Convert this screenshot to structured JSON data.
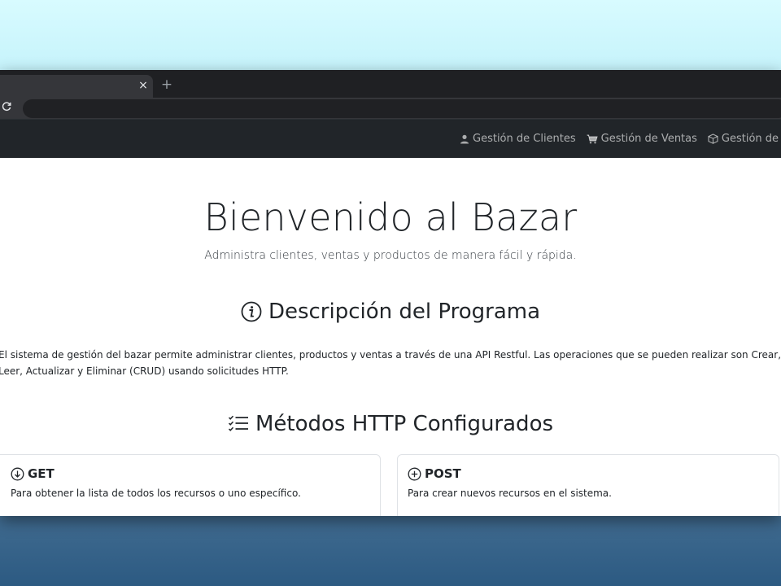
{
  "browser": {
    "tab_close": "×",
    "new_tab": "+",
    "reload": "C",
    "address": ""
  },
  "navbar": {
    "links": [
      {
        "label": "Gestión de Clientes",
        "icon": "person-icon"
      },
      {
        "label": "Gestión de Ventas",
        "icon": "cart-icon"
      },
      {
        "label": "Gestión de Productos",
        "icon": "box-icon"
      }
    ]
  },
  "hero": {
    "title": "Bienvenido al Bazar",
    "subtitle": "Administra clientes, ventas y productos de manera fácil y rápida."
  },
  "description": {
    "title": "Descripción del Programa",
    "icon": "info-circle-icon",
    "text": "El sistema de gestión del bazar permite administrar clientes, productos y ventas a través de una API Restful. Las operaciones que se pueden realizar son Crear, Leer, Actualizar y Eliminar (CRUD) usando solicitudes HTTP."
  },
  "methods": {
    "title": "Métodos HTTP Configurados",
    "icon": "list-check-icon",
    "cards": [
      {
        "name": "GET",
        "icon": "arrow-down-circle-icon",
        "text": "Para obtener la lista de todos los recursos o uno específico."
      },
      {
        "name": "POST",
        "icon": "plus-circle-icon",
        "text": "Para crear nuevos recursos en el sistema."
      }
    ]
  },
  "colors": {
    "navbar": "#212529",
    "tabstrip": "#1f2023",
    "toolbar": "#35363a",
    "text": "#212529"
  }
}
